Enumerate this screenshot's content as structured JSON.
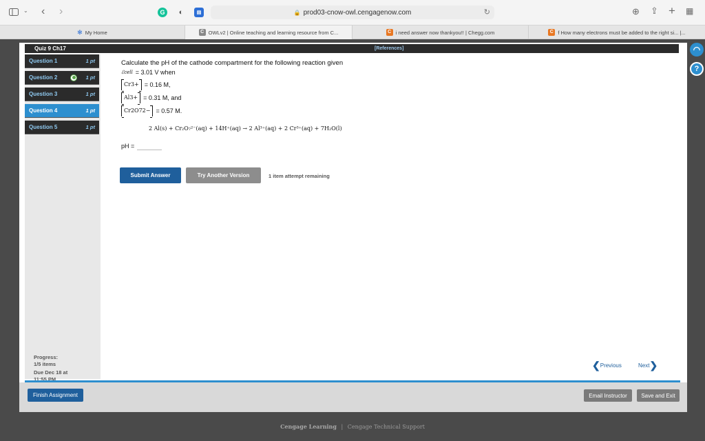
{
  "browser": {
    "url": "prod03-cnow-owl.cengagenow.com",
    "tabs": [
      {
        "label": "My Home",
        "icon": "sparkle-icon"
      },
      {
        "label": "OWLv2 | Online teaching and learning resource from C...",
        "icon": "cengage-icon"
      },
      {
        "label": "i need answer now thankyou!! | Chegg.com",
        "icon": "chegg-icon"
      },
      {
        "label": "f How many electrons must be added to the right si... |...",
        "icon": "chegg-icon"
      }
    ]
  },
  "header": {
    "quiz_title": "Quiz 9 Ch17",
    "references": "[References]"
  },
  "sidebar": {
    "questions": [
      {
        "label": "Question 1",
        "points": "1 pt",
        "answered": false,
        "active": false
      },
      {
        "label": "Question 2",
        "points": "1 pt",
        "answered": true,
        "active": false
      },
      {
        "label": "Question 3",
        "points": "1 pt",
        "answered": false,
        "active": false
      },
      {
        "label": "Question 4",
        "points": "1 pt",
        "answered": false,
        "active": true
      },
      {
        "label": "Question 5",
        "points": "1 pt",
        "answered": false,
        "active": false
      }
    ],
    "progress_label": "Progress:",
    "progress_value": "1/5 items",
    "due_line1": "Due Dec 18 at",
    "due_line2": "11:55 PM"
  },
  "question": {
    "prompt": "Calculate the pH of the cathode compartment for the following reaction given",
    "ecell_label": "ℰcell",
    "ecell_value": "= 3.01 V when",
    "c1_species": "Cr3+",
    "c1_value": "= 0.16 M,",
    "c2_species": "Al3+",
    "c2_value": "= 0.31 M, and",
    "c3_species": "Cr2O72−",
    "c3_value": "= 0.57 M.",
    "reaction": "2 Al(s) + Cr₂O₇²⁻(aq) + 14H⁺(aq) → 2 Al³⁺(aq) + 2 Cr³⁺(aq) + 7H₂O(l)",
    "answer_label": "pH =",
    "answer_value": ""
  },
  "actions": {
    "submit": "Submit Answer",
    "try_another": "Try Another Version",
    "attempts": "1 item attempt remaining",
    "previous": "Previous",
    "next": "Next",
    "finish": "Finish Assignment",
    "email": "Email Instructor",
    "save_exit": "Save and Exit"
  },
  "footer": {
    "brand": "Cengage Learning",
    "sep": "|",
    "support": "Cengage Technical Support"
  },
  "colors": {
    "primary": "#1f5f9c",
    "active_tab": "#2d8fcf",
    "dark": "#2b2b2b",
    "grey_button": "#8d8d8d"
  }
}
